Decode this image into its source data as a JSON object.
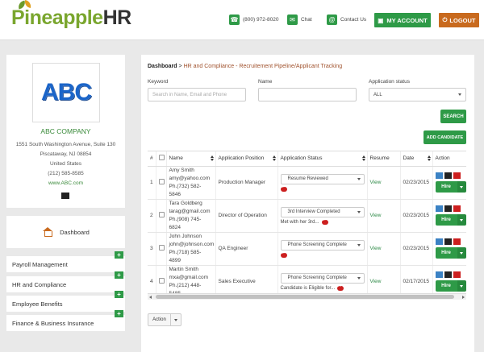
{
  "header": {
    "logo_part1": "Pineapple",
    "logo_part2": "HR",
    "phone": "(800) 972-8020",
    "chat": "Chat",
    "contact": "Contact Us",
    "my_account": "MY ACCOUNT",
    "logout": "LOGOUT"
  },
  "company": {
    "logo_text": "ABC",
    "name": "ABC COMPANY",
    "address1": "1551 South Washington Avenue, Suite 130",
    "address2": "Piscataway, NJ 08854",
    "country": "United States",
    "phone": "(212) 585-8585",
    "website": "www.ABC.com"
  },
  "sidebar": {
    "dashboard": "Dashboard",
    "items": [
      {
        "label": "Payroll Management"
      },
      {
        "label": "HR and Compliance"
      },
      {
        "label": "Employee Benefits"
      },
      {
        "label": "Finance & Business Insurance"
      }
    ]
  },
  "breadcrumb": {
    "root": "Dashboard",
    "sep": ">",
    "crumb1": "HR and Compliance",
    "sep2": "-",
    "crumb2": "Recruitement Pipeline/Applicant Tracking"
  },
  "filters": {
    "keyword_label": "Keyword",
    "keyword_placeholder": "Search in Name, Email and Phone",
    "name_label": "Name",
    "name_value": "",
    "status_label": "Application status",
    "status_value": "ALL",
    "search_button": "SEARCH",
    "add_button": "ADD CANDIDATE"
  },
  "table": {
    "columns": {
      "num": "#",
      "name": "Name",
      "position": "Application Position",
      "status": "Application Status",
      "resume": "Resume",
      "date": "Date",
      "action": "Action"
    },
    "rows": [
      {
        "num": "1",
        "name": "Amy Smith",
        "email": "amy@yahoo.com",
        "phone": "Ph.(732) 582-5846",
        "position": "Production Manager",
        "status": "Resume Reviewed",
        "note": "",
        "resume": "View",
        "date": "02/23/2015",
        "hire": "Hire"
      },
      {
        "num": "2",
        "name": "Tara Goldberg",
        "email": "tarag@gmail.com",
        "phone": "Ph.(908) 745-6824",
        "position": "Director of Operation",
        "status": "3rd Interview Completed",
        "note": "Met with her 3rd...",
        "resume": "View",
        "date": "02/23/2015",
        "hire": "Hire"
      },
      {
        "num": "3",
        "name": "John Johnson",
        "email": "john@johnson.com",
        "phone": "Ph.(718) 585-4899",
        "position": "QA Engineer",
        "status": "Phone Screening Complete",
        "note": "",
        "resume": "View",
        "date": "02/23/2015",
        "hire": "Hire"
      },
      {
        "num": "4",
        "name": "Martin Smith",
        "email": "mxa@gmail.com",
        "phone": "Ph.(212) 448-5485",
        "position": "Sales Executive",
        "status": "Phone Screening Complete",
        "note": "Candidate is Eligible for...",
        "resume": "View",
        "date": "02/17/2015",
        "hire": "Hire"
      }
    ]
  },
  "bulk_action": "Action",
  "icons": {
    "phone": "phone-icon",
    "chat": "chat-icon",
    "contact": "contact-icon",
    "account": "user-icon",
    "logout": "logout-icon",
    "dashboard": "home-icon",
    "note": "comment-bubble-icon"
  },
  "colors": {
    "brand_green": "#2e9a47",
    "logout_orange": "#c86a1e",
    "note_red": "#cc1f1f"
  }
}
